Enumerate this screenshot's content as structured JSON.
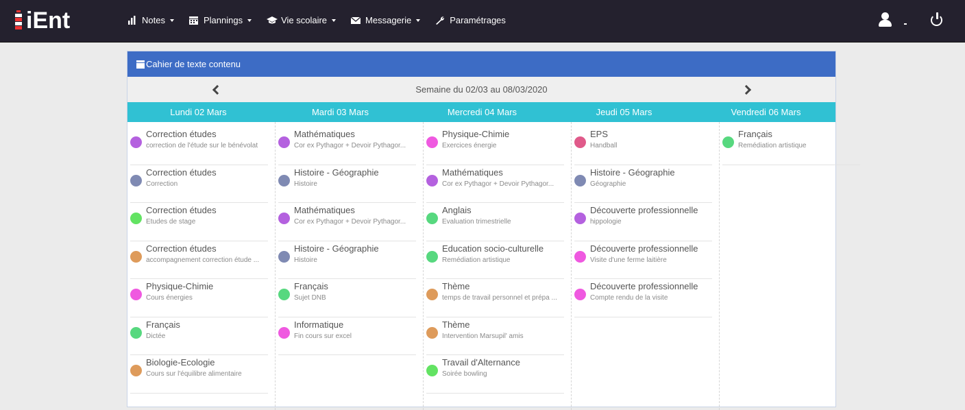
{
  "app": {
    "logo_text": "iEnt"
  },
  "nav": {
    "items": [
      {
        "label": "Notes",
        "icon": "bar-chart-icon",
        "dropdown": true
      },
      {
        "label": "Plannings",
        "icon": "calendar-icon",
        "dropdown": true
      },
      {
        "label": "Vie scolaire",
        "icon": "graduation-cap-icon",
        "dropdown": true
      },
      {
        "label": "Messagerie",
        "icon": "envelope-icon",
        "dropdown": true
      },
      {
        "label": "Paramétrages",
        "icon": "wrench-icon",
        "dropdown": false
      }
    ]
  },
  "panel": {
    "title": "Cahier de texte contenu",
    "week_label": "Semaine du 02/03 au 08/03/2020"
  },
  "colors": {
    "topbar": "#24212e",
    "panel_header": "#3d6cc5",
    "day_header": "#30c1d3",
    "purple": "#b461df",
    "gray": "#7f8ab3",
    "green": "#57d87f",
    "bright_green": "#63e363",
    "orange": "#de9b5b",
    "pink": "#ef59e0",
    "red_pink": "#e05a8a"
  },
  "days": [
    {
      "label": "Lundi 02 Mars",
      "entries": [
        {
          "subject": "Correction études",
          "desc": "correction de l'étude sur le bénévolat",
          "color": "#b461df"
        },
        {
          "subject": "Correction études",
          "desc": "Correction",
          "color": "#7f8ab3"
        },
        {
          "subject": "Correction études",
          "desc": "Etudes de stage",
          "color": "#63e363"
        },
        {
          "subject": "Correction études",
          "desc": "accompagnement correction étude ...",
          "color": "#de9b5b"
        },
        {
          "subject": "Physique-Chimie",
          "desc": "Cours énergies",
          "color": "#ef59e0"
        },
        {
          "subject": "Français",
          "desc": "Dictée",
          "color": "#57d87f"
        },
        {
          "subject": "Biologie-Ecologie",
          "desc": "Cours sur l'équilibre alimentaire",
          "color": "#de9b5b"
        }
      ]
    },
    {
      "label": "Mardi 03 Mars",
      "entries": [
        {
          "subject": "Mathématiques",
          "desc": "Cor ex Pythagor + Devoir Pythagor...",
          "color": "#b461df"
        },
        {
          "subject": "Histoire - Géographie",
          "desc": "Histoire",
          "color": "#7f8ab3"
        },
        {
          "subject": "Mathématiques",
          "desc": "Cor ex Pythagor + Devoir Pythagor...",
          "color": "#b461df"
        },
        {
          "subject": "Histoire - Géographie",
          "desc": "Histoire",
          "color": "#7f8ab3"
        },
        {
          "subject": "Français",
          "desc": "Sujet DNB",
          "color": "#57d87f"
        },
        {
          "subject": "Informatique",
          "desc": "Fin cours sur excel",
          "color": "#ef59e0"
        }
      ]
    },
    {
      "label": "Mercredi 04 Mars",
      "entries": [
        {
          "subject": "Physique-Chimie",
          "desc": "Exercices énergie",
          "color": "#ef59e0"
        },
        {
          "subject": "Mathématiques",
          "desc": "Cor ex Pythagor + Devoir Pythagor...",
          "color": "#b461df"
        },
        {
          "subject": "Anglais",
          "desc": "Evaluation trimestrielle",
          "color": "#57d87f"
        },
        {
          "subject": "Education socio-culturelle",
          "desc": "Remédiation artistique",
          "color": "#57d87f"
        },
        {
          "subject": "Thème",
          "desc": "temps de travail personnel et prépa ...",
          "color": "#de9b5b"
        },
        {
          "subject": "Thème",
          "desc": "Intervention Marsupil' amis",
          "color": "#de9b5b"
        },
        {
          "subject": "Travail d'Alternance",
          "desc": "Soirée bowling",
          "color": "#63e363"
        }
      ]
    },
    {
      "label": "Jeudi 05 Mars",
      "entries": [
        {
          "subject": "EPS",
          "desc": "Handball",
          "color": "#e05a8a"
        },
        {
          "subject": "Histoire - Géographie",
          "desc": "Géographie",
          "color": "#7f8ab3"
        },
        {
          "subject": "Découverte professionnelle",
          "desc": "hippologie",
          "color": "#b461df"
        },
        {
          "subject": "Découverte professionnelle",
          "desc": "Visite d'une ferme laitière",
          "color": "#ef59e0"
        },
        {
          "subject": "Découverte professionnelle",
          "desc": "Compte rendu de la visite",
          "color": "#ef59e0"
        }
      ]
    },
    {
      "label": "Vendredi 06 Mars",
      "entries": [
        {
          "subject": "Français",
          "desc": "Remédiation artistique",
          "color": "#57d87f"
        }
      ]
    }
  ]
}
